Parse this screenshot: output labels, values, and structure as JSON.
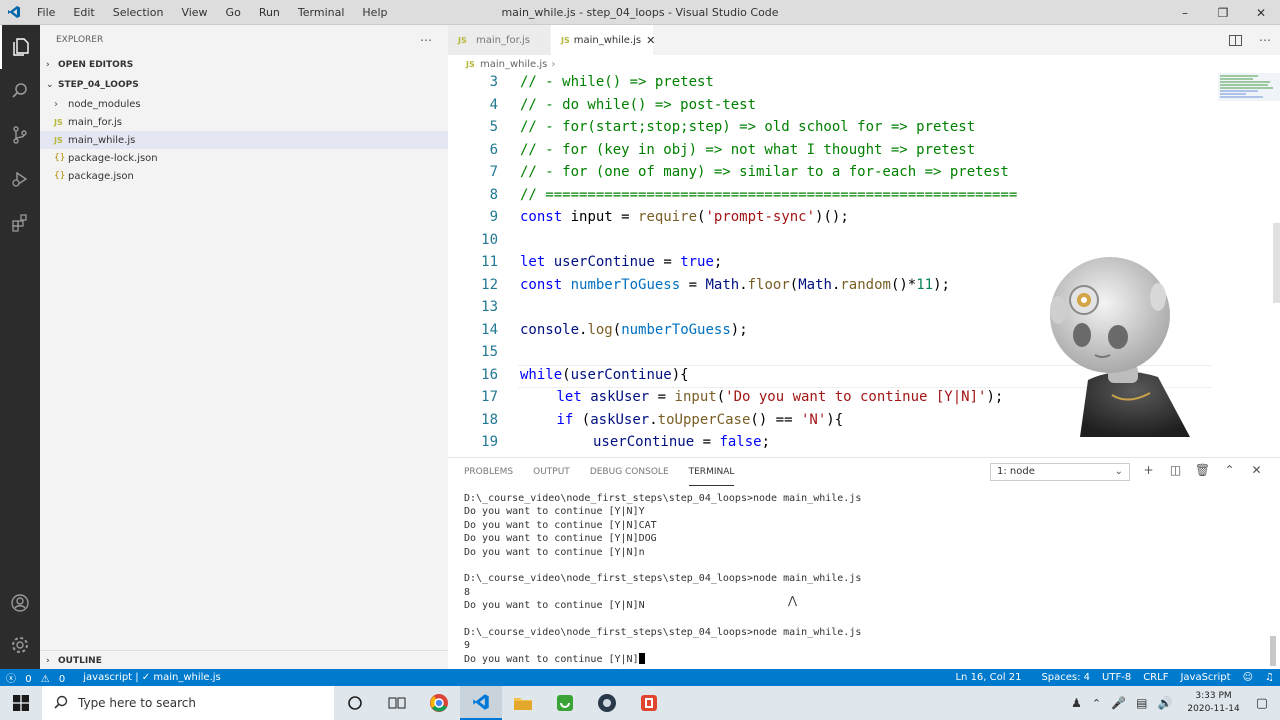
{
  "window": {
    "title": "main_while.js - step_04_loops - Visual Studio Code",
    "menu": [
      "File",
      "Edit",
      "Selection",
      "View",
      "Go",
      "Run",
      "Terminal",
      "Help"
    ]
  },
  "sidebar": {
    "title": "EXPLORER",
    "open_editors": "OPEN EDITORS",
    "folder": "STEP_04_LOOPS",
    "items": [
      {
        "label": "node_modules",
        "type": "folder"
      },
      {
        "label": "main_for.js",
        "type": "js"
      },
      {
        "label": "main_while.js",
        "type": "js"
      },
      {
        "label": "package-lock.json",
        "type": "json"
      },
      {
        "label": "package.json",
        "type": "json"
      }
    ],
    "outline": "OUTLINE"
  },
  "tabs": [
    {
      "label": "main_for.js"
    },
    {
      "label": "main_while.js"
    }
  ],
  "breadcrumb": "main_while.js",
  "code_lines": [
    {
      "n": "3",
      "text": "// - while() => pretest"
    },
    {
      "n": "4",
      "text": "// - do while() => post-test"
    },
    {
      "n": "5",
      "text": "// - for(start;stop;step) => old school for => pretest"
    },
    {
      "n": "6",
      "text": "// - for (key in obj) => not what I thought => pretest"
    },
    {
      "n": "7",
      "text": "// - for (one of many) => similar to a for-each => pretest"
    },
    {
      "n": "8",
      "text": "// ========================================================"
    },
    {
      "n": "9",
      "text": "const input = require('prompt-sync')();"
    },
    {
      "n": "10",
      "text": ""
    },
    {
      "n": "11",
      "text": "let userContinue = true;"
    },
    {
      "n": "12",
      "text": "const numberToGuess = Math.floor(Math.random()*11);"
    },
    {
      "n": "13",
      "text": ""
    },
    {
      "n": "14",
      "text": "console.log(numberToGuess);"
    },
    {
      "n": "15",
      "text": ""
    },
    {
      "n": "16",
      "text": "while(userContinue){"
    },
    {
      "n": "17",
      "text": "let askUser = input('Do you want to continue [Y|N]');"
    },
    {
      "n": "18",
      "text": "if (askUser.toUpperCase() == 'N'){"
    },
    {
      "n": "19",
      "text": "userContinue = false;"
    }
  ],
  "panel": {
    "tabs": [
      "PROBLEMS",
      "OUTPUT",
      "DEBUG CONSOLE",
      "TERMINAL"
    ],
    "terminal_select": "1: node",
    "terminal_lines": [
      "D:\\_course_video\\node_first_steps\\step_04_loops>node main_while.js",
      "Do you want to continue [Y|N]Y",
      "Do you want to continue [Y|N]CAT",
      "Do you want to continue [Y|N]DOG",
      "Do you want to continue [Y|N]n",
      "",
      "D:\\_course_video\\node_first_steps\\step_04_loops>node main_while.js",
      "8",
      "Do you want to continue [Y|N]N",
      "",
      "D:\\_course_video\\node_first_steps\\step_04_loops>node main_while.js",
      "9",
      "Do you want to continue [Y|N]"
    ]
  },
  "status": {
    "errors": "0",
    "warnings": "0",
    "left_item": "javascript | ✓ main_while.js",
    "position": "Ln 16, Col 21",
    "spaces": "Spaces: 4",
    "encoding": "UTF-8",
    "eol": "CRLF",
    "language": "JavaScript"
  },
  "taskbar": {
    "search_placeholder": "Type here to search",
    "time": "3:33 PM",
    "date": "2020-11-14"
  },
  "colors": {
    "statusbar": "#007acc",
    "activitybar": "#2c2c2c",
    "sidebar": "#f3f3f3",
    "comment": "#008000",
    "keyword": "#0000ff",
    "string": "#a31515"
  }
}
